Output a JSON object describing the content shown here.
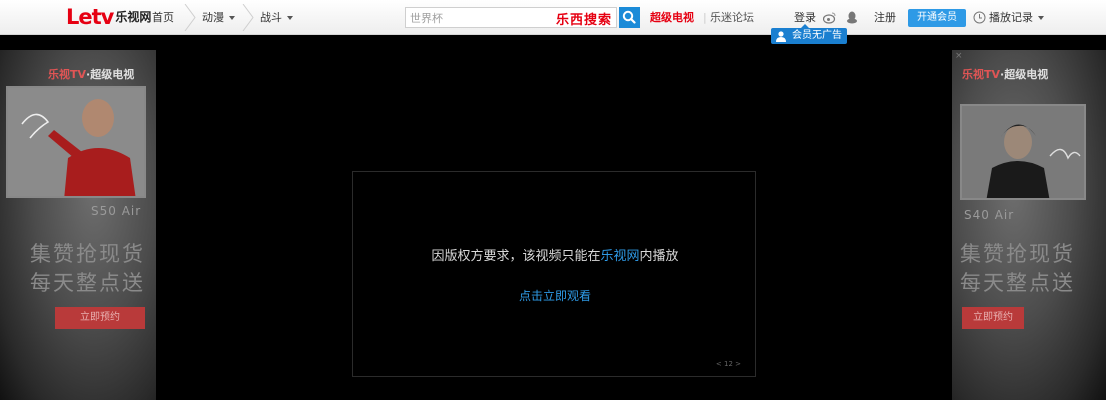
{
  "logo": {
    "letv": "Letv",
    "cn": "乐视网"
  },
  "nav": {
    "home": "首页",
    "cat1": "动漫",
    "cat2": "战斗"
  },
  "search": {
    "placeholder": "世界杯",
    "brand": "乐西搜索"
  },
  "links": {
    "super_tv": "超级电视",
    "forum": "乐迷论坛",
    "login": "登录",
    "register": "注册",
    "vip": "开通会员",
    "history": "播放记录",
    "ad_free": "会员无广告"
  },
  "left_ad": {
    "brand_red": "乐视TV",
    "brand_rest": "·超级电视",
    "model": "S50 Air",
    "slogan1": "集赞抢现货",
    "slogan2": "每天整点送",
    "button": "立即预约"
  },
  "right_ad": {
    "brand_red": "乐视TV",
    "brand_rest": "·超级电视",
    "model": "S40 Air",
    "slogan1": "集赞抢现货",
    "slogan2": "每天整点送",
    "button": "立即预约"
  },
  "player": {
    "message_before": "因版权方要求，该视频只能在",
    "message_brand": "乐视网",
    "message_after": "内播放",
    "watch_link": "点击立即观看",
    "pager": "< 12 >"
  },
  "colors": {
    "accent": "#2e9ae6",
    "brand_red": "#e60012"
  }
}
